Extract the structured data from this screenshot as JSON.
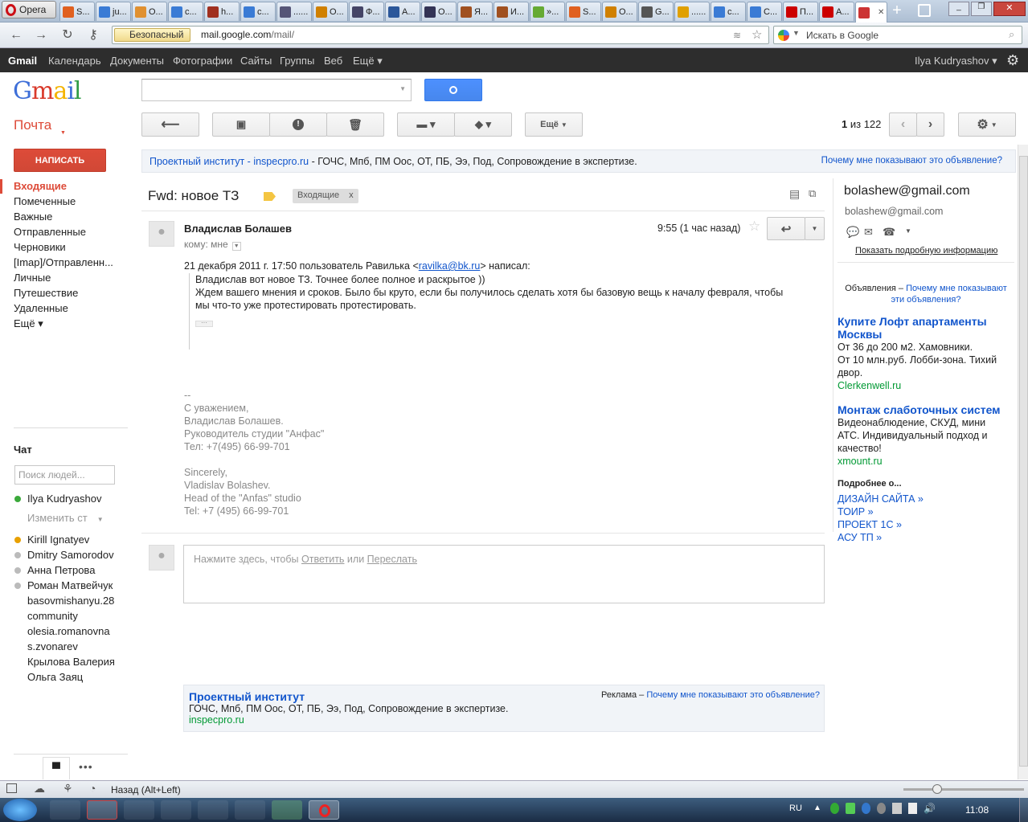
{
  "browser": {
    "opera_label": "Opera",
    "tabs": [
      {
        "label": "S...",
        "color": "#e06020"
      },
      {
        "label": "ju...",
        "color": "#3a7bd5"
      },
      {
        "label": "O...",
        "color": "#e09030"
      },
      {
        "label": "c...",
        "color": "#3a7bd5"
      },
      {
        "label": "h...",
        "color": "#a03020"
      },
      {
        "label": "c...",
        "color": "#3a7bd5"
      },
      {
        "label": "......",
        "color": "#557"
      },
      {
        "label": "O...",
        "color": "#d08000"
      },
      {
        "label": "Ф...",
        "color": "#446"
      },
      {
        "label": "A...",
        "color": "#2b579a"
      },
      {
        "label": "O...",
        "color": "#335"
      },
      {
        "label": "Я...",
        "color": "#a05020"
      },
      {
        "label": "И...",
        "color": "#a05020"
      },
      {
        "label": "»...",
        "color": "#6a3"
      },
      {
        "label": "S...",
        "color": "#e06020"
      },
      {
        "label": "O...",
        "color": "#d08000"
      },
      {
        "label": "G...",
        "color": "#555"
      },
      {
        "label": "......",
        "color": "#e0a000"
      },
      {
        "label": "c...",
        "color": "#3a7bd5"
      },
      {
        "label": "C...",
        "color": "#3a7bd5"
      },
      {
        "label": "П...",
        "color": "#c00"
      },
      {
        "label": "A...",
        "color": "#c00"
      },
      {
        "label": "",
        "color": "#c33",
        "active": true
      }
    ],
    "secure_label": "Безопасный",
    "url_host": "mail.google.com",
    "url_path": "/mail/",
    "search_placeholder": "Искать в Google"
  },
  "gbar": {
    "items": [
      "Gmail",
      "Календарь",
      "Документы",
      "Фотографии",
      "Сайты",
      "Группы",
      "Веб",
      "Ещё ▾"
    ],
    "user": "Ilya Kudryashov ▾"
  },
  "header": {
    "logo": "Gmail",
    "search_value": ""
  },
  "toolbar": {
    "mail_label": "Почта",
    "more_label": "Ещё",
    "pagination": "1",
    "pagination_rest": "из 122"
  },
  "compose_label": "НАПИСАТЬ",
  "sidebar": {
    "items": [
      "Входящие",
      "Помеченные",
      "Важные",
      "Отправленные",
      "Черновики",
      "[Imap]/Отправленн...",
      "Личные",
      "Путешествие",
      "Удаленные",
      "Ещё ▾"
    ]
  },
  "chat": {
    "title": "Чат",
    "search_placeholder": "Поиск людей...",
    "me": "Ilya Kudryashov",
    "status_link": "Изменить ст",
    "contacts": [
      {
        "name": "Kirill Ignatyev",
        "status": "#e8a000"
      },
      {
        "name": "Dmitry Samorodov",
        "status": "#bbb"
      },
      {
        "name": "Анна Петрова",
        "status": "#bbb"
      },
      {
        "name": "Роман Матвейчук",
        "status": "#bbb"
      },
      {
        "name": "basovmishanyu.28",
        "status": ""
      },
      {
        "name": "community",
        "status": ""
      },
      {
        "name": "olesia.romanovna",
        "status": ""
      },
      {
        "name": "s.zvonarev",
        "status": ""
      },
      {
        "name": "Крылова Валерия",
        "status": ""
      },
      {
        "name": "Ольга Заяц",
        "status": ""
      }
    ]
  },
  "top_ad": {
    "title": "Проектный институт",
    "sep": " - ",
    "domain": "inspecpro.ru",
    "text": " - ГОЧС, Мпб, ПМ Оос, ОТ, ПБ, Ээ, Под, Сопровождение в экспертизе.",
    "why": "Почему мне показывают это объявление?"
  },
  "message": {
    "subject": "Fwd: новое ТЗ",
    "label": "Входящие",
    "label_remove": "x",
    "sender": "Владислав Болашев",
    "to": "кому: мне",
    "time": "9:55 (1 час назад)",
    "intro_prefix": "21 декабря 2011 г. 17:50 пользователь Равилька <",
    "intro_email": "ravilka@bk.ru",
    "intro_suffix": "> написал:",
    "quote": [
      "Владислав вот новое ТЗ. Точнее более полное и раскрытое ))",
      "Ждем вашего мнения и сроков. Было бы круто, если бы получилось сделать хотя бы базовую вещь к началу февраля, чтобы",
      "мы что-то уже протестировать протестировать."
    ],
    "signature": [
      "--",
      "С уважением,",
      "Владислав Болашев.",
      "Руководитель студии \"Анфас\"",
      "Тел: +7(495) 66-99-701",
      "",
      "Sincerely,",
      "Vladislav Bolashev.",
      "Head of the \"Anfas\" studio",
      "Tel: +7 (495) 66-99-701"
    ]
  },
  "reply_box": {
    "prefix": "Нажмите здесь, чтобы ",
    "reply": "Ответить",
    "or": " или ",
    "forward": "Переслать"
  },
  "bottom_ad": {
    "title": "Проектный институт",
    "text": "ГОЧС, Мпб, ПМ Оос, ОТ, ПБ, Ээ, Под, Сопровождение в экспертизе.",
    "domain": "inspecpro.ru",
    "label": "Реклама –",
    "why": "Почему мне показывают это объявление?"
  },
  "right": {
    "contact_name": "bolashew@gmail.com",
    "contact_email": "bolashew@gmail.com",
    "details_link": "Показать подробную информацию",
    "ads_label": "Объявления – ",
    "ads_why": "Почему мне показывают эти объявления?",
    "ads": [
      {
        "title": "Купите Лофт апартаменты Москвы",
        "lines": [
          "От 36 до 200 м2. Хамовники.",
          "От 10 млн.руб. Лобби-зона. Тихий двор."
        ],
        "domain": "Clerkenwell.ru"
      },
      {
        "title": "Монтаж слаботочных систем",
        "lines": [
          "Видеонаблюдение, СКУД, мини АТС. Индивидуальный подход и качество!"
        ],
        "domain": "xmount.ru"
      }
    ],
    "more_title": "Подробнее о...",
    "more_links": [
      "ДИЗАЙН САЙТА »",
      "ТОИР »",
      "ПРОЕКТ 1С »",
      "АСУ ТП »"
    ]
  },
  "status": {
    "text": "Назад (Alt+Left)"
  },
  "taskbar": {
    "lang": "RU",
    "clock": "11:08"
  }
}
